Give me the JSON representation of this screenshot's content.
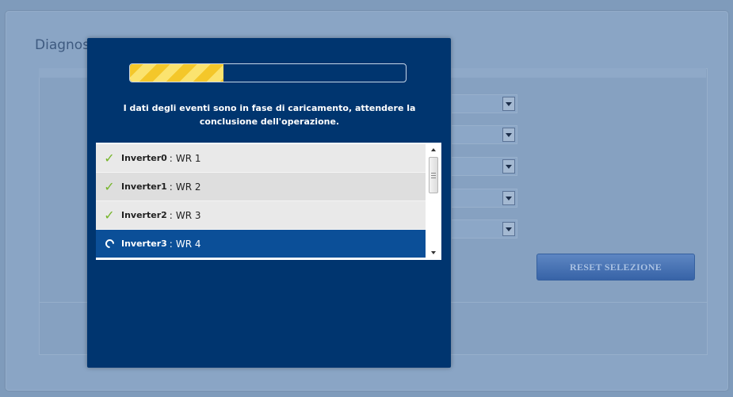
{
  "page": {
    "title": "Diagnostica"
  },
  "background_form": {
    "select_count": 5,
    "reset_button_label": "RESET SELEZIONE"
  },
  "modal": {
    "progress_fraction": 0.34,
    "message": "I dati degli eventi sono in fase di caricamento, attendere la conclusione dell'operazione.",
    "items": [
      {
        "name": "Inverter0",
        "label": "WR 1",
        "status": "done",
        "status_icon": "check-icon"
      },
      {
        "name": "Inverter1",
        "label": "WR 2",
        "status": "done",
        "status_icon": "check-icon"
      },
      {
        "name": "Inverter2",
        "label": "WR 3",
        "status": "done",
        "status_icon": "check-icon"
      },
      {
        "name": "Inverter3",
        "label": "WR 4",
        "status": "loading",
        "status_icon": "spinner-icon"
      }
    ],
    "separator": ":"
  },
  "colors": {
    "modal_bg": "#00356f",
    "active_row": "#0b4f98",
    "progress_stripe_a": "#f4c72a",
    "progress_stripe_b": "#fbe36f",
    "check": "#77b52b"
  }
}
